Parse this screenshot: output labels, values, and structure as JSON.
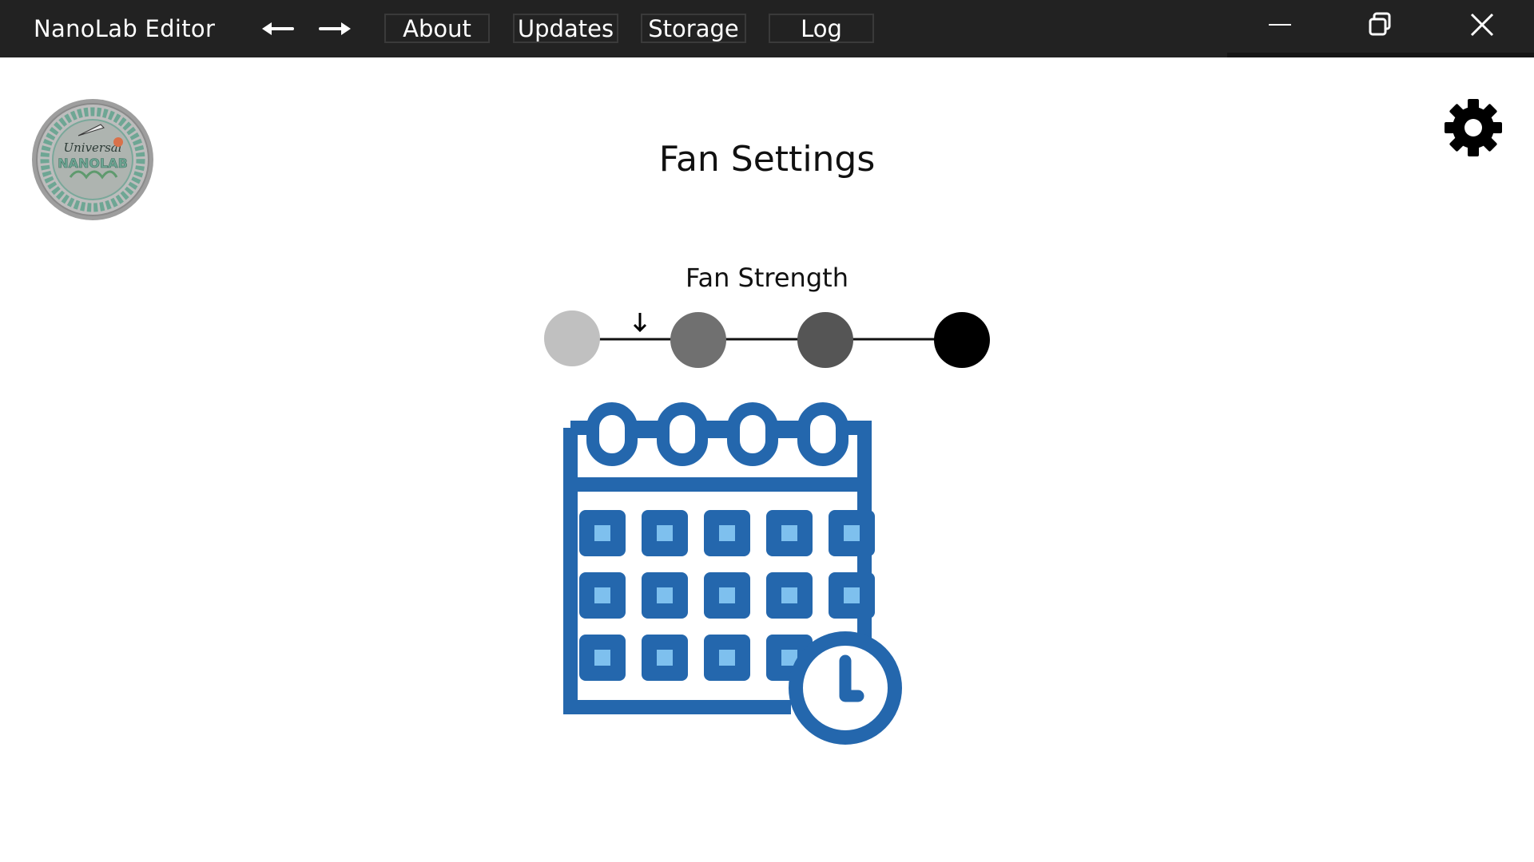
{
  "window": {
    "title": "NanoLab Editor",
    "controls": [
      "minimize-icon",
      "restore-icon",
      "close-icon"
    ]
  },
  "nav": {
    "back_icon": "arrow-left-icon",
    "forward_icon": "arrow-right-icon"
  },
  "menu": {
    "about": "About",
    "updates": "Updates",
    "storage": "Storage",
    "log": "Log"
  },
  "logo": {
    "name": "Universal NanoLab seal",
    "lettering": [
      "Universal",
      "NANOLAB",
      "TEIXEIRA-NAVON-BROWN-HSIEH-WELSH",
      "INOUYE-WINKLER-MARCUSON-RAGER-VAN INDY"
    ]
  },
  "page": {
    "title": "Fan Settings",
    "settings_icon": "gear-icon"
  },
  "fan_strength": {
    "label": "Fan Strength",
    "levels": 4,
    "level_colors": [
      "#c0c0c0",
      "#707070",
      "#555555",
      "#000000"
    ],
    "marker_icon": "arrow-down-icon"
  },
  "schedule": {
    "icon": "calendar-clock-icon",
    "colors": {
      "primary": "#2467ad",
      "light": "#7ec0ee"
    }
  },
  "colors": {
    "titlebar_bg": "#222222",
    "background": "#ffffff"
  }
}
